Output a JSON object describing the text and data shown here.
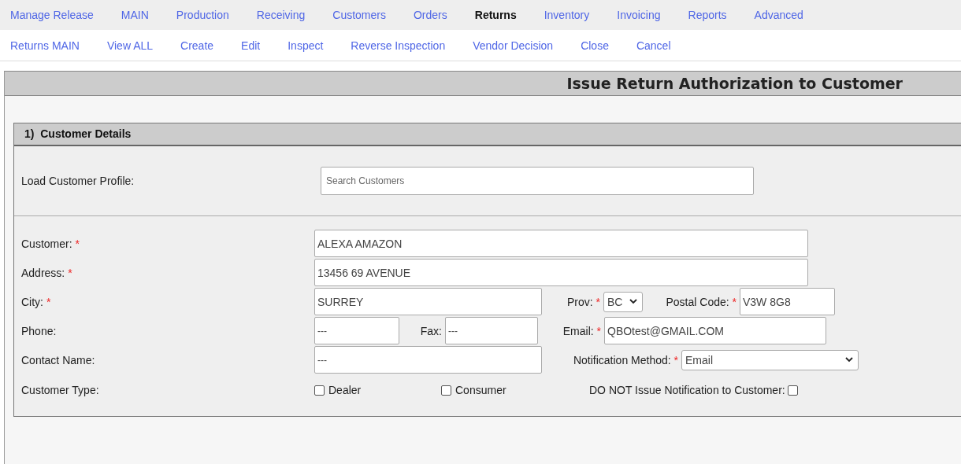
{
  "main_nav": [
    {
      "label": "Manage Release",
      "selected": false
    },
    {
      "label": "MAIN",
      "selected": false
    },
    {
      "label": "Production",
      "selected": false
    },
    {
      "label": "Receiving",
      "selected": false
    },
    {
      "label": "Customers",
      "selected": false
    },
    {
      "label": "Orders",
      "selected": false
    },
    {
      "label": "Returns",
      "selected": true
    },
    {
      "label": "Inventory",
      "selected": false
    },
    {
      "label": "Invoicing",
      "selected": false
    },
    {
      "label": "Reports",
      "selected": false
    },
    {
      "label": "Advanced",
      "selected": false
    }
  ],
  "sub_nav": [
    {
      "label": "Returns MAIN",
      "selected": false
    },
    {
      "label": "View ALL",
      "selected": false
    },
    {
      "label": "Create",
      "selected": false
    },
    {
      "label": "Edit",
      "selected": false
    },
    {
      "label": "Inspect",
      "selected": false
    },
    {
      "label": "Reverse Inspection",
      "selected": false
    },
    {
      "label": "Vendor Decision",
      "selected": false
    },
    {
      "label": "Close",
      "selected": false
    },
    {
      "label": "Cancel",
      "selected": false
    }
  ],
  "page_title": "Issue Return Authorization to Customer",
  "section": {
    "title": "1)  Customer Details",
    "load_profile": {
      "label": "Load Customer Profile:",
      "placeholder": "Search Customers"
    },
    "required_mark": "*",
    "customer": {
      "label": "Customer:",
      "required": true,
      "value": "ALEXA AMAZON"
    },
    "address": {
      "label": "Address:",
      "required": true,
      "value": "13456 69 AVENUE"
    },
    "city": {
      "label": "City:",
      "required": true,
      "value": "SURREY"
    },
    "prov": {
      "label": "Prov:",
      "required": true,
      "value": "BC"
    },
    "postal_code": {
      "label": "Postal Code:",
      "required": true,
      "value": "V3W 8G8"
    },
    "phone": {
      "label": "Phone:",
      "required": false,
      "value": "---"
    },
    "fax": {
      "label": "Fax:",
      "required": false,
      "value": "---"
    },
    "email": {
      "label": "Email:",
      "required": true,
      "value": "QBOtest@GMAIL.COM"
    },
    "contact_name": {
      "label": "Contact Name:",
      "required": false,
      "value": "---"
    },
    "notification_method": {
      "label": "Notification Method:",
      "required": true,
      "value": "Email"
    },
    "customer_type": {
      "label": "Customer Type:",
      "options": [
        {
          "label": "Dealer",
          "checked": false
        },
        {
          "label": "Consumer",
          "checked": false
        }
      ]
    },
    "do_not_notify": {
      "label": "DO NOT Issue Notification to Customer:",
      "checked": false
    }
  }
}
